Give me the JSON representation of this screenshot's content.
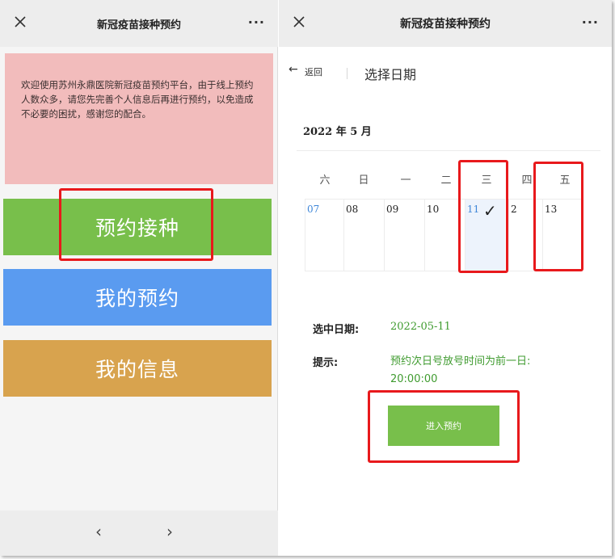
{
  "left": {
    "header_title": "新冠疫苗接种预约",
    "more": "···",
    "notice": "欢迎使用苏州永鼎医院新冠疫苗预约平台，由于线上预约人数众多，请您先完善个人信息后再进行预约，以免造成不必要的困扰，感谢您的配合。",
    "buttons": {
      "book": "预约接种",
      "my_appointments": "我的预约",
      "my_info": "我的信息"
    },
    "footer": {
      "prev": "‹",
      "next": "›"
    }
  },
  "right": {
    "header_title": "新冠疫苗接种预约",
    "more": "···",
    "back_label": "返回",
    "page_title": "选择日期",
    "month_label": "2022 年 5 月",
    "weekdays": [
      "六",
      "日",
      "一",
      "二",
      "三",
      "四",
      "五"
    ],
    "dates": [
      "07",
      "08",
      "09",
      "10",
      "11",
      "2",
      "13"
    ],
    "selected_label": "选中日期:",
    "selected_date": "2022-05-11",
    "hint_label": "提示:",
    "hint_text": "预约次日号放号时间为前一日: 20:00:00",
    "enter_button": "进入预约"
  },
  "colors": {
    "green_button": "#78bf4b",
    "blue_button": "#5a9bf0",
    "orange_button": "#d8a34e",
    "notice_bg": "#f2bcbc",
    "highlight_red": "#e8191c",
    "accent_green_text": "#3f9b2f",
    "link_blue": "#3e86d8"
  }
}
